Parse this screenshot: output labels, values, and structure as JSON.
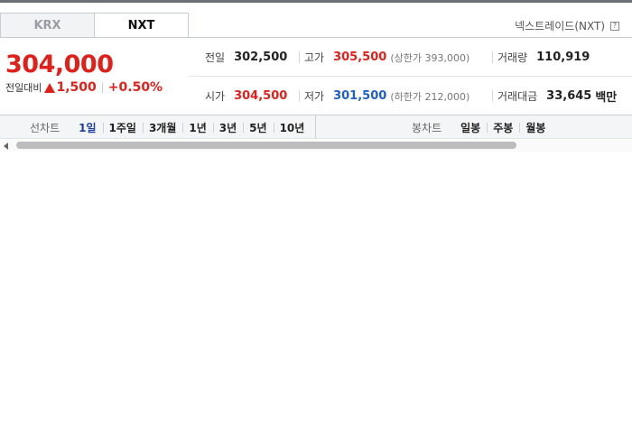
{
  "tabs": [
    {
      "label": "KRX",
      "active": false
    },
    {
      "label": "NXT",
      "active": true
    }
  ],
  "market_source": {
    "label": "넥스트레이드(NXT)",
    "help_icon": "question-icon"
  },
  "quote": {
    "price": "304,000",
    "change_label": "전일대비",
    "change_direction_icon": "up-triangle-icon",
    "change_amount": "1,500",
    "change_percent": "+0.50%"
  },
  "stats": {
    "prev_close": {
      "label": "전일",
      "value": "302,500"
    },
    "high": {
      "label": "고가",
      "value": "305,500",
      "sub": "(상한가 393,000)"
    },
    "volume": {
      "label": "거래량",
      "value": "110,919"
    },
    "open": {
      "label": "시가",
      "value": "304,500"
    },
    "low": {
      "label": "저가",
      "value": "301,500",
      "sub": "(하한가 212,000)"
    },
    "amount": {
      "label": "거래대금",
      "value": "33,645",
      "unit": "백만"
    }
  },
  "line_chart": {
    "title": "선차트",
    "options": [
      "1일",
      "1주일",
      "3개월",
      "1년",
      "3년",
      "5년",
      "10년"
    ],
    "selected": "1일"
  },
  "candle_chart": {
    "title": "봉차트",
    "options": [
      "일봉",
      "주봉",
      "월봉"
    ]
  },
  "colors": {
    "up": "#e0211b",
    "down": "#1f5fc6",
    "selected": "#1f3f9e"
  }
}
